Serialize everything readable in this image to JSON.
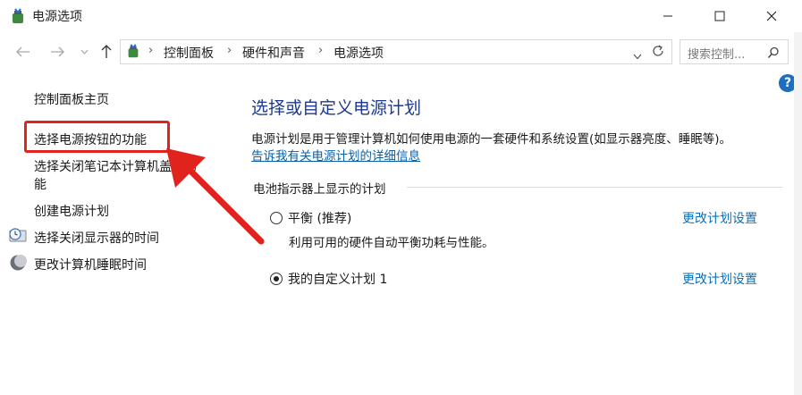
{
  "window": {
    "title": "电源选项",
    "minimize_icon": "minimize-icon",
    "maximize_icon": "maximize-icon",
    "close_icon": "close-icon"
  },
  "address_bar": {
    "breadcrumbs": [
      "控制面板",
      "硬件和声音",
      "电源选项"
    ],
    "separator": "›",
    "search_placeholder": "搜索控制..."
  },
  "sidebar": {
    "items": [
      {
        "label": "控制面板主页"
      },
      {
        "label": "选择电源按钮的功能",
        "highlighted": true
      },
      {
        "label_line1": "选择关闭笔记本计算机盖的功",
        "label_line2": "能"
      },
      {
        "label": "创建电源计划"
      },
      {
        "label": "选择关闭显示器的时间",
        "icon": "monitor-clock-icon"
      },
      {
        "label": "更改计算机睡眠时间",
        "icon": "moon-icon"
      }
    ]
  },
  "main": {
    "title": "选择或自定义电源计划",
    "description": "电源计划是用于管理计算机如何使用电源的一套硬件和系统设置(如显示器亮度、睡眠等)。",
    "info_link": "告诉我有关电源计划的详细信息",
    "group_label": "电池指示器上显示的计划",
    "plans": [
      {
        "name": "平衡 (推荐)",
        "description": "利用可用的硬件自动平衡功耗与性能。",
        "selected": false,
        "change_label": "更改计划设置"
      },
      {
        "name": "我的自定义计划 1",
        "description": "",
        "selected": true,
        "change_label": "更改计划设置"
      }
    ]
  },
  "colors": {
    "highlight_red": "#e0231d",
    "link_blue": "#0b6fb8",
    "title_blue": "#1e3a8a",
    "help_blue": "#1b6ec2"
  }
}
